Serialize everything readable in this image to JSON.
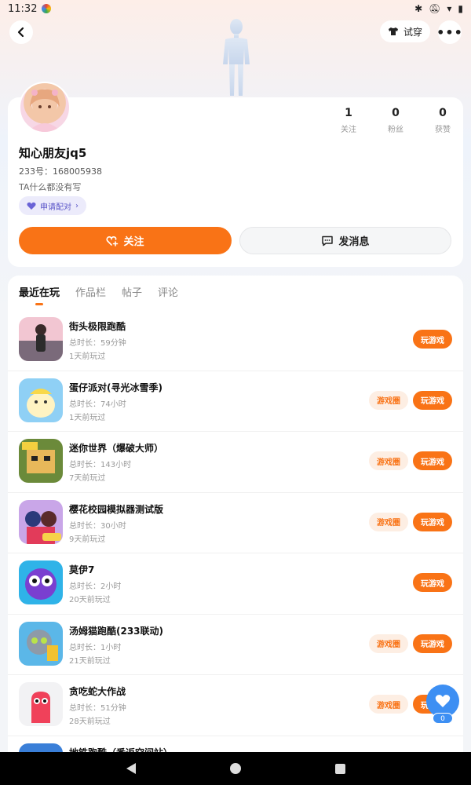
{
  "status_bar": {
    "time": "11:32"
  },
  "topbar": {
    "tryon_label": "试穿",
    "more_label": "•••"
  },
  "profile": {
    "stats": [
      {
        "value": "1",
        "label": "关注"
      },
      {
        "value": "0",
        "label": "粉丝"
      },
      {
        "value": "0",
        "label": "获赞"
      }
    ],
    "nickname": "知心朋友jq5",
    "uid": "233号：168005938",
    "bio": "TA什么都没有写",
    "pair_label": "申请配对",
    "follow_label": "关注",
    "message_label": "发消息"
  },
  "tabs": [
    "最近在玩",
    "作品栏",
    "帖子",
    "评论"
  ],
  "games": [
    {
      "name": "街头极限跑酷",
      "duration": "总时长：59分钟",
      "last": "1天前玩过",
      "has_circle": false
    },
    {
      "name": "蛋仔派对(寻光冰雪季)",
      "duration": "总时长：74小时",
      "last": "1天前玩过",
      "has_circle": true
    },
    {
      "name": "迷你世界（爆破大师）",
      "duration": "总时长：143小时",
      "last": "7天前玩过",
      "has_circle": true
    },
    {
      "name": "樱花校园模拟器测试版",
      "duration": "总时长：30小时",
      "last": "9天前玩过",
      "has_circle": true
    },
    {
      "name": "莫伊7",
      "duration": "总时长：2小时",
      "last": "20天前玩过",
      "has_circle": false
    },
    {
      "name": "汤姆猫跑酷(233联动)",
      "duration": "总时长：1小时",
      "last": "21天前玩过",
      "has_circle": true
    },
    {
      "name": "贪吃蛇大作战",
      "duration": "总时长：51分钟",
      "last": "28天前玩过",
      "has_circle": true
    },
    {
      "name": "地铁跑酷（番返空间站）",
      "duration": "",
      "last": "",
      "has_circle": false
    }
  ],
  "buttons": {
    "play_label": "玩游戏",
    "circle_label": "游戏圈"
  },
  "like": {
    "count": "0"
  },
  "colors": {
    "accent": "#f97316",
    "like_blue": "#3d8ff3",
    "pair_purple": "#5a55c8"
  }
}
